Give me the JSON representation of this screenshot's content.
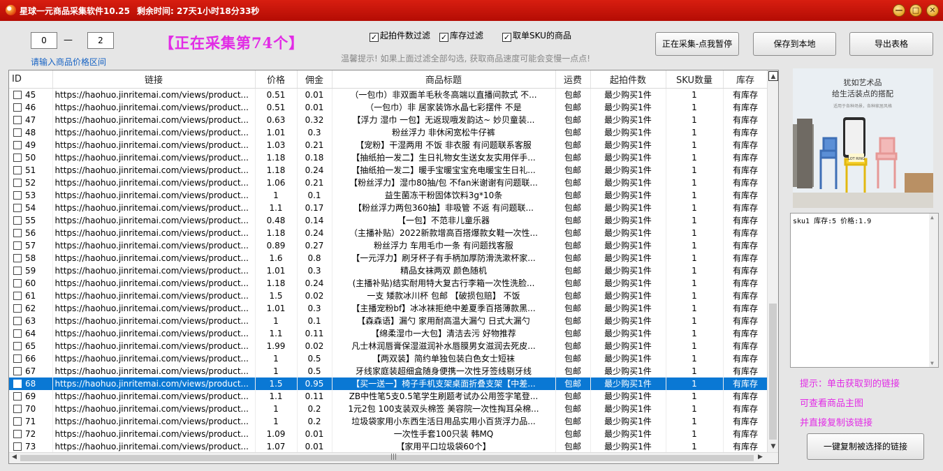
{
  "window": {
    "title": "星球一元商品采集软件10.25",
    "remaining": "剩余时间: 27天1小时18分33秒",
    "min_btn": "—",
    "max_btn": "□",
    "close_btn": "✕"
  },
  "filters": {
    "price_min": "0",
    "price_dash": "—",
    "price_max": "2",
    "price_hint": "请输入商品价格区间",
    "status": "【正在采集第74个】",
    "cb_min_qty": "起拍件数过滤",
    "cb_stock": "库存过滤",
    "cb_single_sku": "取单SKU的商品",
    "warm_tip": "温馨提示! 如果上面过滤全部勾选, 获取商品速度可能会变慢一点点!"
  },
  "buttons": {
    "pause": "正在采集-点我暂停",
    "save": "保存到本地",
    "export": "导出表格",
    "copy_selected": "一键复制被选择的链接"
  },
  "table": {
    "headers": [
      "ID",
      "链接",
      "价格",
      "佣金",
      "商品标题",
      "运费",
      "起拍件数",
      "SKU数量",
      "库存"
    ],
    "selected_id": "68",
    "rows": [
      {
        "id": "45",
        "link": "https://haohuo.jinritemai.com/views/product...",
        "price": "0.51",
        "commission": "0.01",
        "title": "（一包巾）非双面羊毛秋冬高端以直播间款式 不...",
        "shipping": "包邮",
        "min": "最少购买1件",
        "sku": "1",
        "stock": "有库存"
      },
      {
        "id": "46",
        "link": "https://haohuo.jinritemai.com/views/product...",
        "price": "0.51",
        "commission": "0.01",
        "title": "（一包巾）非 居家装饰水晶七彩摆件 不是",
        "shipping": "包邮",
        "min": "最少购买1件",
        "sku": "1",
        "stock": "有库存"
      },
      {
        "id": "47",
        "link": "https://haohuo.jinritemai.com/views/product...",
        "price": "0.63",
        "commission": "0.32",
        "title": "【浮力 湿巾 一包】无返现哦发韵达~ 妙贝童装...",
        "shipping": "包邮",
        "min": "最少购买1件",
        "sku": "1",
        "stock": "有库存"
      },
      {
        "id": "48",
        "link": "https://haohuo.jinritemai.com/views/product...",
        "price": "1.01",
        "commission": "0.3",
        "title": "粉丝浮力 非休闲宽松牛仔裤",
        "shipping": "包邮",
        "min": "最少购买1件",
        "sku": "1",
        "stock": "有库存"
      },
      {
        "id": "49",
        "link": "https://haohuo.jinritemai.com/views/product...",
        "price": "1.03",
        "commission": "0.21",
        "title": "【宠粉】干湿两用 不饭 非衣服 有问题联系客服",
        "shipping": "包邮",
        "min": "最少购买1件",
        "sku": "1",
        "stock": "有库存"
      },
      {
        "id": "50",
        "link": "https://haohuo.jinritemai.com/views/product...",
        "price": "1.18",
        "commission": "0.18",
        "title": "【抽纸拍一发二】生日礼物女生送女友实用伴手...",
        "shipping": "包邮",
        "min": "最少购买1件",
        "sku": "1",
        "stock": "有库存"
      },
      {
        "id": "51",
        "link": "https://haohuo.jinritemai.com/views/product...",
        "price": "1.18",
        "commission": "0.24",
        "title": "【抽纸拍一发二】暖手宝暖宝宝充电暖宝生日礼...",
        "shipping": "包邮",
        "min": "最少购买1件",
        "sku": "1",
        "stock": "有库存"
      },
      {
        "id": "52",
        "link": "https://haohuo.jinritemai.com/views/product...",
        "price": "1.06",
        "commission": "0.21",
        "title": "【粉丝浮力】湿巾80抽/包 不fan米谢谢有问题联...",
        "shipping": "包邮",
        "min": "最少购买1件",
        "sku": "1",
        "stock": "有库存"
      },
      {
        "id": "53",
        "link": "https://haohuo.jinritemai.com/views/product...",
        "price": "1",
        "commission": "0.1",
        "title": "益生菌冻干粉固体饮料3g*10条",
        "shipping": "包邮",
        "min": "最少购买1件",
        "sku": "1",
        "stock": "有库存"
      },
      {
        "id": "54",
        "link": "https://haohuo.jinritemai.com/views/product...",
        "price": "1.1",
        "commission": "0.17",
        "title": "【粉丝浮力两包360抽】非吸管 不返 有问题联...",
        "shipping": "包邮",
        "min": "最少购买1件",
        "sku": "1",
        "stock": "有库存"
      },
      {
        "id": "55",
        "link": "https://haohuo.jinritemai.com/views/product...",
        "price": "0.48",
        "commission": "0.14",
        "title": "【一包】不范非儿童乐器",
        "shipping": "包邮",
        "min": "最少购买1件",
        "sku": "1",
        "stock": "有库存"
      },
      {
        "id": "56",
        "link": "https://haohuo.jinritemai.com/views/product...",
        "price": "1.18",
        "commission": "0.24",
        "title": "（主播补贴）2022新款增高百搭爆款女鞋一次性...",
        "shipping": "包邮",
        "min": "最少购买1件",
        "sku": "1",
        "stock": "有库存"
      },
      {
        "id": "57",
        "link": "https://haohuo.jinritemai.com/views/product...",
        "price": "0.89",
        "commission": "0.27",
        "title": "粉丝浮力 车用毛巾一条 有问题找客服",
        "shipping": "包邮",
        "min": "最少购买1件",
        "sku": "1",
        "stock": "有库存"
      },
      {
        "id": "58",
        "link": "https://haohuo.jinritemai.com/views/product...",
        "price": "1.6",
        "commission": "0.8",
        "title": "【一元浮力】刷牙杯子有手柄加厚防滑洗漱杯家...",
        "shipping": "包邮",
        "min": "最少购买1件",
        "sku": "1",
        "stock": "有库存"
      },
      {
        "id": "59",
        "link": "https://haohuo.jinritemai.com/views/product...",
        "price": "1.01",
        "commission": "0.3",
        "title": "精品女袜两双 颜色随机",
        "shipping": "包邮",
        "min": "最少购买1件",
        "sku": "1",
        "stock": "有库存"
      },
      {
        "id": "60",
        "link": "https://haohuo.jinritemai.com/views/product...",
        "price": "1.18",
        "commission": "0.24",
        "title": "(主播补贴)结实耐用特大复古行李箱一次性洗脸...",
        "shipping": "包邮",
        "min": "最少购买1件",
        "sku": "1",
        "stock": "有库存"
      },
      {
        "id": "61",
        "link": "https://haohuo.jinritemai.com/views/product...",
        "price": "1.5",
        "commission": "0.02",
        "title": "一支 矮款冰川杯 包邮 【破损包赔】 不饭",
        "shipping": "包邮",
        "min": "最少购买1件",
        "sku": "1",
        "stock": "有库存"
      },
      {
        "id": "62",
        "link": "https://haohuo.jinritemai.com/views/product...",
        "price": "1.01",
        "commission": "0.3",
        "title": "【主播宠粉bf】冰冰袜拒绝中差夏季百搭薄款黑...",
        "shipping": "包邮",
        "min": "最少购买1件",
        "sku": "1",
        "stock": "有库存"
      },
      {
        "id": "63",
        "link": "https://haohuo.jinritemai.com/views/product...",
        "price": "1",
        "commission": "0.1",
        "title": "【森森语】漏勺 家用耐高温大漏勺 日式大漏勺",
        "shipping": "包邮",
        "min": "最少购买1件",
        "sku": "1",
        "stock": "有库存"
      },
      {
        "id": "64",
        "link": "https://haohuo.jinritemai.com/views/product...",
        "price": "1.1",
        "commission": "0.11",
        "title": "【绵柔湿巾一大包】清洁去污 好物推荐",
        "shipping": "包邮",
        "min": "最少购买1件",
        "sku": "1",
        "stock": "有库存"
      },
      {
        "id": "65",
        "link": "https://haohuo.jinritemai.com/views/product...",
        "price": "1.99",
        "commission": "0.02",
        "title": "凡士林润唇膏保湿滋润补水唇膜男女滋润去死皮...",
        "shipping": "包邮",
        "min": "最少购买1件",
        "sku": "1",
        "stock": "有库存"
      },
      {
        "id": "66",
        "link": "https://haohuo.jinritemai.com/views/product...",
        "price": "1",
        "commission": "0.5",
        "title": "【两双装】简约单独包装白色女士短袜",
        "shipping": "包邮",
        "min": "最少购买1件",
        "sku": "1",
        "stock": "有库存"
      },
      {
        "id": "67",
        "link": "https://haohuo.jinritemai.com/views/product...",
        "price": "1",
        "commission": "0.5",
        "title": "牙线家庭装超细盒随身便携一次性牙签线剔牙线",
        "shipping": "包邮",
        "min": "最少购买1件",
        "sku": "1",
        "stock": "有库存"
      },
      {
        "id": "68",
        "link": "https://haohuo.jinritemai.com/views/product...",
        "price": "1.5",
        "commission": "0.95",
        "title": "【买一送一】椅子手机支架桌面折叠支架【中差...",
        "shipping": "包邮",
        "min": "最少购买1件",
        "sku": "1",
        "stock": "有库存"
      },
      {
        "id": "69",
        "link": "https://haohuo.jinritemai.com/views/product...",
        "price": "1.1",
        "commission": "0.11",
        "title": "ZB中性笔5支0.5笔学生刷题考试办公用签字笔登...",
        "shipping": "包邮",
        "min": "最少购买1件",
        "sku": "1",
        "stock": "有库存"
      },
      {
        "id": "70",
        "link": "https://haohuo.jinritemai.com/views/product...",
        "price": "1",
        "commission": "0.2",
        "title": "1元2包 100支装双头棉签 美容院一次性掏耳朵棉...",
        "shipping": "包邮",
        "min": "最少购买1件",
        "sku": "1",
        "stock": "有库存"
      },
      {
        "id": "71",
        "link": "https://haohuo.jinritemai.com/views/product...",
        "price": "1",
        "commission": "0.2",
        "title": "垃圾袋家用小东西生活日用品实用小百货浮力品...",
        "shipping": "包邮",
        "min": "最少购买1件",
        "sku": "1",
        "stock": "有库存"
      },
      {
        "id": "72",
        "link": "https://haohuo.jinritemai.com/views/product...",
        "price": "1.09",
        "commission": "0.01",
        "title": "一次性手套100只装 韩MQ",
        "shipping": "包邮",
        "min": "最少购买1件",
        "sku": "1",
        "stock": "有库存"
      },
      {
        "id": "73",
        "link": "https://haohuo.jinritemai.com/views/product...",
        "price": "1.07",
        "commission": "0.01",
        "title": "【家用平口垃圾袋60个】",
        "shipping": "包邮",
        "min": "最少购买1件",
        "sku": "1",
        "stock": "有库存"
      }
    ]
  },
  "side": {
    "image_caption_line1": "犹如艺术品",
    "image_caption_line2": "给生活装点的搭配",
    "image_sub": "适用于各种场景，各种家居风格",
    "image_chair_label": "LOT RING",
    "sku_text": "sku1  库存:5  价格:1.9",
    "tip1": "提示：单击获取到的链接",
    "tip2": "可查看商品主图",
    "tip3": "并直接复制该链接"
  },
  "colors": {
    "title_bar": "#c8150a",
    "accent_magenta": "#e22be6",
    "selection": "#0a78d4",
    "link_blue": "#1763c4"
  }
}
